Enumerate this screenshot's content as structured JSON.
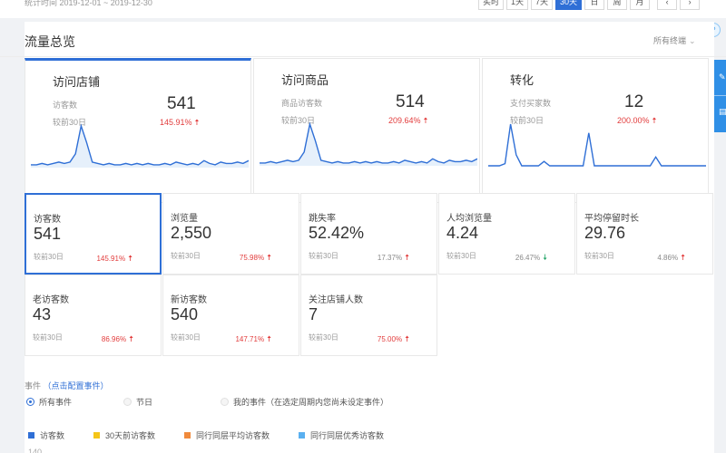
{
  "topbar": {
    "stat_time": "统计时间 2019-12-01 ~ 2019-12-30",
    "ranges": [
      "实时",
      "1天",
      "7天",
      "30天",
      "日",
      "周",
      "月"
    ],
    "active_range": "30天",
    "prev_label": "‹",
    "next_label": "›"
  },
  "panel": {
    "title": "流量总览",
    "dimension_select": "所有终端"
  },
  "overview": [
    {
      "title": "访问店铺",
      "metric": "访客数",
      "value": "541",
      "compare": "较前30日",
      "pct": "145.91%",
      "trend": "up",
      "spark": [
        2,
        2,
        3,
        2,
        3,
        4,
        3,
        4,
        10,
        30,
        18,
        4,
        3,
        2,
        3,
        2,
        2,
        3,
        2,
        3,
        2,
        3,
        2,
        2,
        3,
        2,
        4,
        3,
        2,
        3,
        2,
        5,
        3,
        2,
        4,
        3,
        3,
        4,
        3,
        5
      ]
    },
    {
      "title": "访问商品",
      "metric": "商品访客数",
      "value": "514",
      "compare": "较前30日",
      "pct": "209.64%",
      "trend": "up",
      "spark": [
        2,
        2,
        3,
        2,
        3,
        4,
        3,
        4,
        10,
        30,
        18,
        4,
        3,
        2,
        3,
        2,
        2,
        3,
        2,
        3,
        2,
        3,
        2,
        2,
        3,
        2,
        4,
        3,
        2,
        3,
        2,
        5,
        3,
        2,
        4,
        3,
        3,
        4,
        3,
        5
      ]
    },
    {
      "title": "转化",
      "metric": "支付买家数",
      "value": "12",
      "compare": "较前30日",
      "pct": "200.00%",
      "trend": "up",
      "spark": [
        0,
        0,
        0,
        2,
        38,
        10,
        0,
        0,
        0,
        0,
        4,
        0,
        0,
        0,
        0,
        0,
        0,
        0,
        30,
        0,
        0,
        0,
        0,
        0,
        0,
        0,
        0,
        0,
        0,
        0,
        8,
        0,
        0,
        0,
        0,
        0,
        0,
        0,
        0,
        0
      ]
    }
  ],
  "tiles": [
    {
      "label": "访客数",
      "value": "541",
      "compare": "较前30日",
      "pct": "145.91%",
      "trend": "up"
    },
    {
      "label": "浏览量",
      "value": "2,550",
      "compare": "较前30日",
      "pct": "75.98%",
      "trend": "up"
    },
    {
      "label": "跳失率",
      "value": "52.42%",
      "compare": "较前30日",
      "pct": "17.37%",
      "trend": "up"
    },
    {
      "label": "人均浏览量",
      "value": "4.24",
      "compare": "较前30日",
      "pct": "26.47%",
      "trend": "down"
    },
    {
      "label": "平均停留时长",
      "value": "29.76",
      "compare": "较前30日",
      "pct": "4.86%",
      "trend": "up"
    },
    {
      "label": "老访客数",
      "value": "43",
      "compare": "较前30日",
      "pct": "86.96%",
      "trend": "up"
    },
    {
      "label": "新访客数",
      "value": "540",
      "compare": "较前30日",
      "pct": "147.71%",
      "trend": "up"
    },
    {
      "label": "关注店铺人数",
      "value": "7",
      "compare": "较前30日",
      "pct": "75.00%",
      "trend": "up"
    }
  ],
  "events": {
    "label": "事件",
    "link_text": "（点击配置事件）",
    "options": [
      "所有事件",
      "节日",
      "我的事件（在选定周期内您尚未设定事件）"
    ]
  },
  "legend": [
    {
      "label": "访客数",
      "color": "#2f6fd6"
    },
    {
      "label": "30天前访客数",
      "color": "#f5c518"
    },
    {
      "label": "同行同层平均访客数",
      "color": "#f08a3c"
    },
    {
      "label": "同行同层优秀访客数",
      "color": "#5ab0f0"
    }
  ],
  "chart_tick": "140",
  "colors": {
    "accent": "#2f6fd6",
    "up": "#e23c3c",
    "down": "#21a366",
    "spark_fill": "#e6f0fb"
  }
}
